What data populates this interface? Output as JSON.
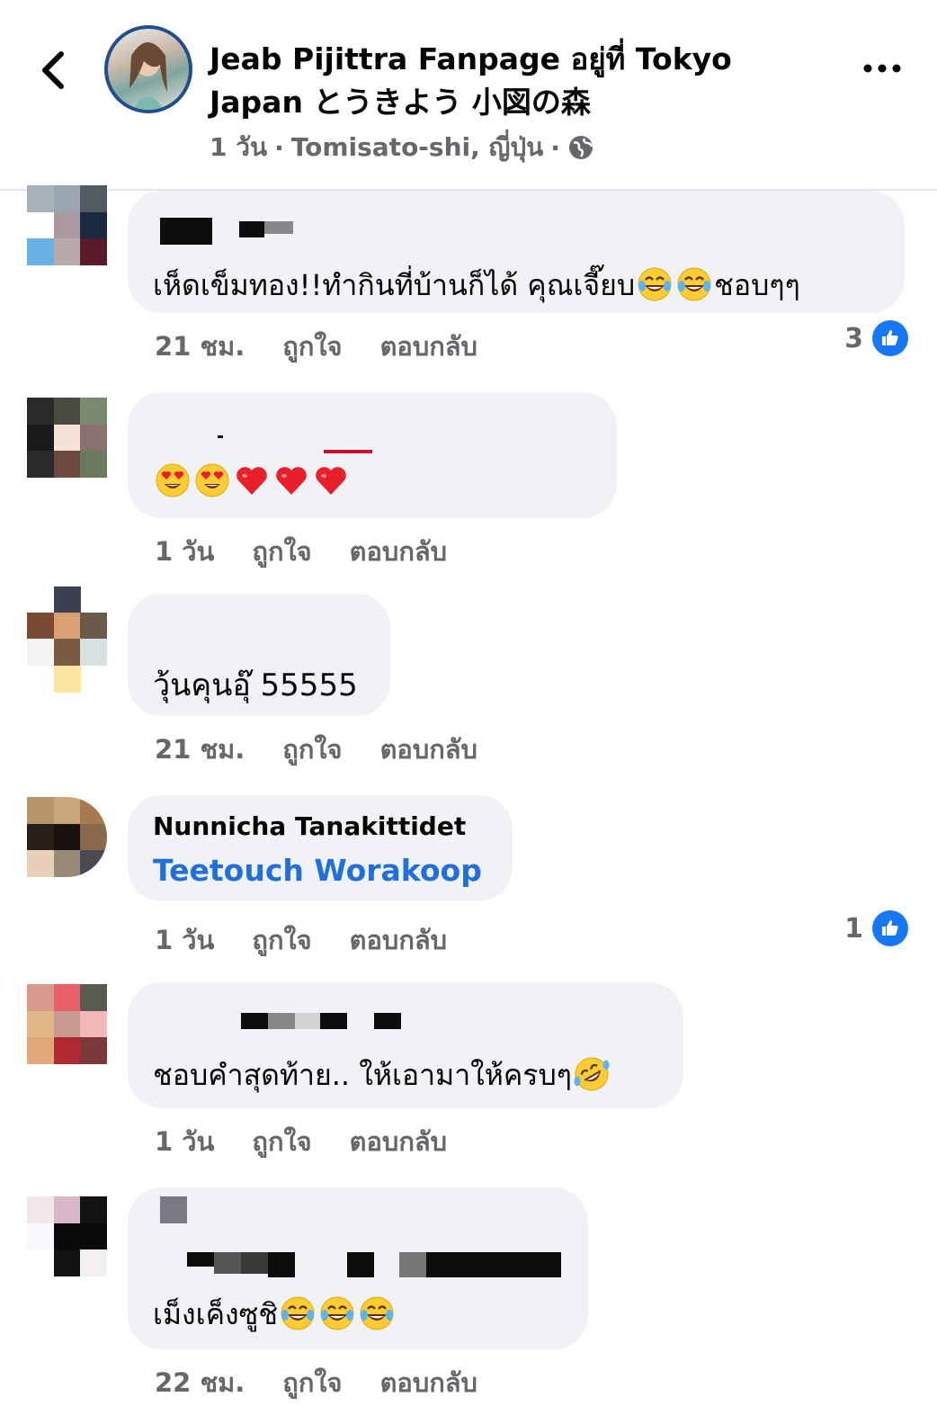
{
  "header": {
    "title": "Jeab Pijittra Fanpage อยู่ที่ Tokyo Japan とうきよう 小図の森",
    "time": "1 วัน",
    "location": "Tomisato-shi, ญี่ปุ่น",
    "separator": "·",
    "back_icon": "chevron-left-icon",
    "more_icon": "more-horizontal-icon",
    "privacy_icon": "globe-icon"
  },
  "actions": {
    "like": "ถูกใจ",
    "reply": "ตอบกลับ"
  },
  "colors": {
    "like_blue": "#1877f2",
    "bubble_bg": "#f0f2f5",
    "mention_blue": "#216fdb",
    "meta_gray": "#65676b"
  },
  "comments": [
    {
      "text": "เห็ดเข็มทอง!!ทำกินที่บ้านก็ได้ คุณเจี๊ยบ",
      "text_suffix": "ชอบๆๆ",
      "emojis": [
        "face-with-tears-of-joy-icon",
        "face-with-tears-of-joy-icon"
      ],
      "time": "21 ชม.",
      "reactions": "3"
    },
    {
      "text": "",
      "emojis": [
        "heart-eyes-icon",
        "heart-eyes-icon",
        "red-heart-icon",
        "red-heart-icon",
        "red-heart-icon"
      ],
      "time": "1 วัน"
    },
    {
      "text": "วุ้นคุนอุ๊ 55555",
      "time": "21 ชม."
    },
    {
      "name": "Nunnicha Tanakittidet",
      "mention": "Teetouch Worakoop",
      "time": "1 วัน",
      "reactions": "1"
    },
    {
      "text": "ชอบคำสุดท้าย.. ให้เอามาให้ครบๆ",
      "emojis": [
        "rolling-on-floor-laughing-icon"
      ],
      "time": "1 วัน"
    },
    {
      "text": "เม็งเค็งซูชิ",
      "emojis": [
        "face-with-tears-of-joy-icon",
        "face-with-tears-of-joy-icon",
        "face-with-tears-of-joy-icon"
      ],
      "time": "22 ชม."
    }
  ]
}
